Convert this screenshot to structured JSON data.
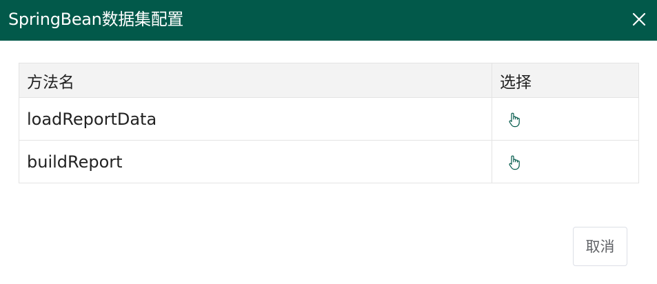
{
  "dialog": {
    "title": "SpringBean数据集配置",
    "header_color": "#02594a",
    "close_icon": "close-icon"
  },
  "table": {
    "columns": [
      {
        "label": "方法名"
      },
      {
        "label": "选择"
      }
    ],
    "rows": [
      {
        "method": "loadReportData",
        "select_icon": "hand-pointer-icon"
      },
      {
        "method": "buildReport",
        "select_icon": "hand-pointer-icon"
      }
    ]
  },
  "footer": {
    "cancel_label": "取消"
  }
}
